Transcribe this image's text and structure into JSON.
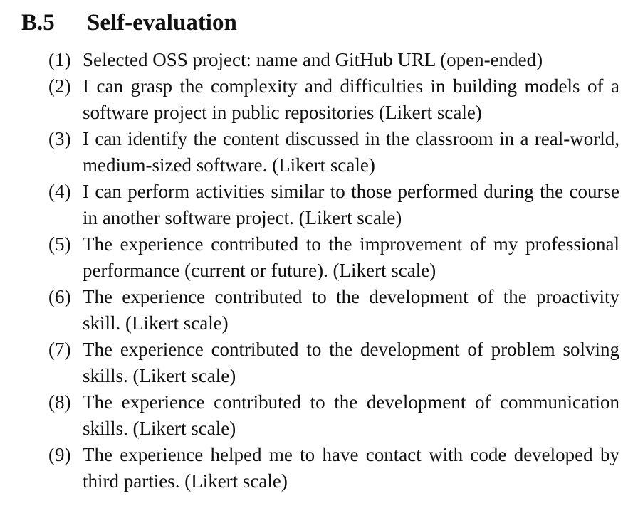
{
  "section": {
    "number": "B.5",
    "title": "Self-evaluation"
  },
  "items": [
    {
      "label": "(1)",
      "text": "Selected OSS project: name and GitHub URL (open-ended)"
    },
    {
      "label": "(2)",
      "text": "I can grasp the complexity and difficulties in building models of a software project in public repositories (Likert scale)"
    },
    {
      "label": "(3)",
      "text": "I can identify the content discussed in the classroom in a real-world, medium-sized software. (Likert scale)"
    },
    {
      "label": "(4)",
      "text": "I can perform activities similar to those performed during the course in another software project. (Likert scale)"
    },
    {
      "label": "(5)",
      "text": "The experience contributed to the improvement of my professional performance (current or future). (Likert scale)"
    },
    {
      "label": "(6)",
      "text": "The experience contributed to the development of the proactivity skill. (Likert scale)"
    },
    {
      "label": "(7)",
      "text": "The experience contributed to the development of problem solving skills. (Likert scale)"
    },
    {
      "label": "(8)",
      "text": "The experience contributed to the development of communication skills. (Likert scale)"
    },
    {
      "label": "(9)",
      "text": "The experience helped me to have contact with code developed by third parties. (Likert scale)"
    }
  ]
}
